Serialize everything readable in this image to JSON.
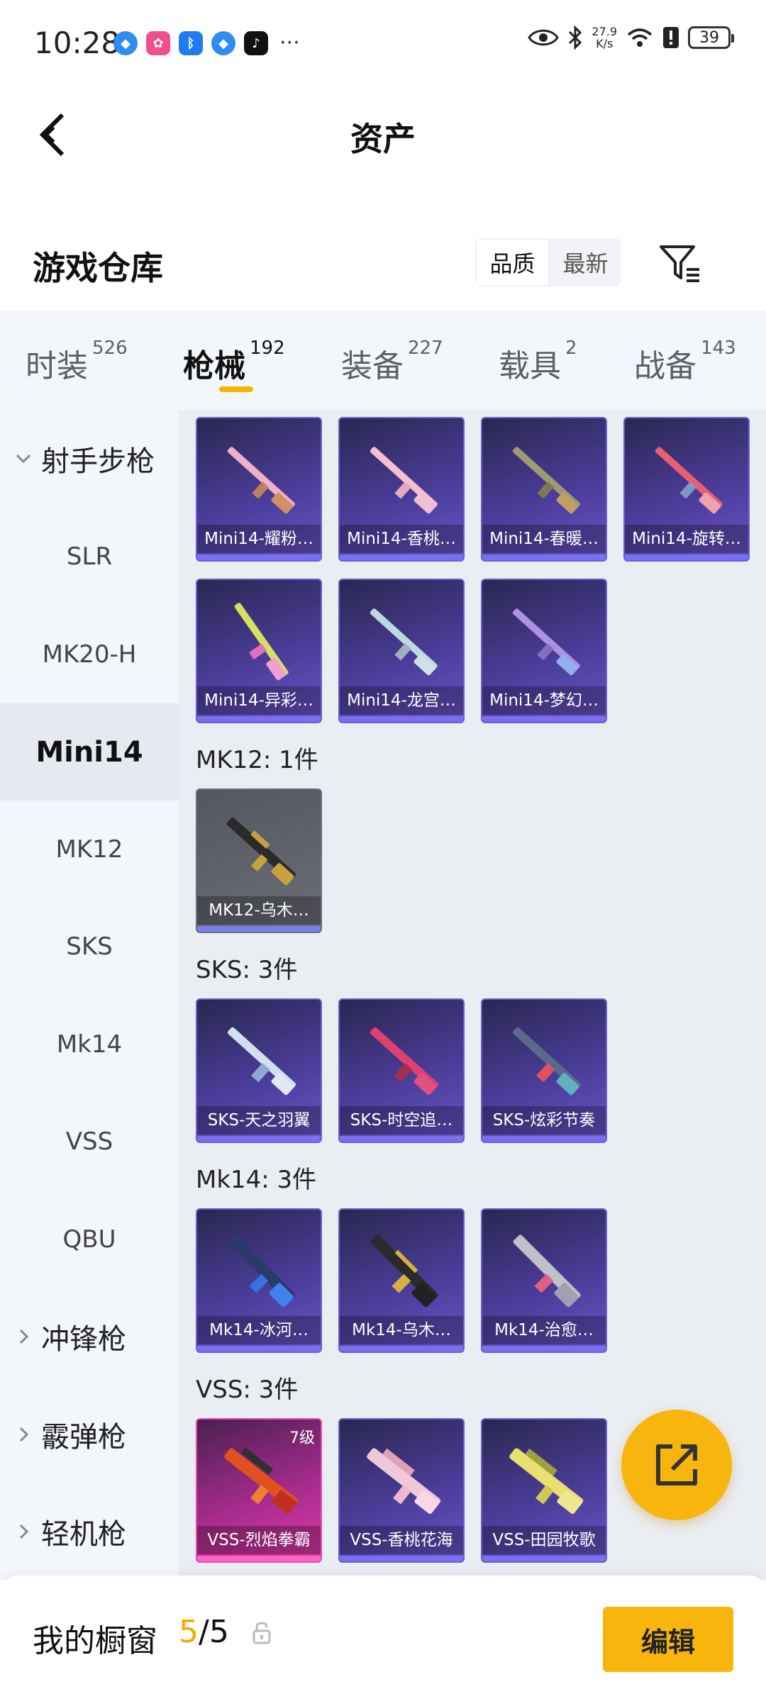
{
  "status_bar": {
    "time": "10:28",
    "speed_value": "27.9",
    "speed_unit": "K/s",
    "battery": "39",
    "more": "···"
  },
  "nav": {
    "title": "资产"
  },
  "header": {
    "section_title": "游戏仓库",
    "sort_options": [
      "品质",
      "最新"
    ],
    "active_sort": "品质"
  },
  "tabs": [
    {
      "label": "时装",
      "count": "526"
    },
    {
      "label": "枪械",
      "count": "192"
    },
    {
      "label": "装备",
      "count": "227"
    },
    {
      "label": "载具",
      "count": "2"
    },
    {
      "label": "战备",
      "count": "143"
    }
  ],
  "active_tab": "枪械",
  "sidebar": {
    "group_open": "射手步枪",
    "items": [
      "SLR",
      "MK20-H",
      "Mini14",
      "MK12",
      "SKS",
      "Mk14",
      "VSS",
      "QBU"
    ],
    "active_item": "Mini14",
    "collapsed_groups": [
      "冲锋枪",
      "霰弹枪",
      "轻机枪"
    ]
  },
  "content": {
    "mini14_items": [
      "Mini14-耀粉…",
      "Mini14-香桃…",
      "Mini14-春暖…",
      "Mini14-旋转…",
      "Mini14-异彩…",
      "Mini14-龙宫…",
      "Mini14-梦幻…"
    ],
    "groups": [
      {
        "label": "MK12: 1件",
        "items": [
          "MK12-乌木…"
        ]
      },
      {
        "label": "SKS: 3件",
        "items": [
          "SKS-天之羽翼",
          "SKS-时空追…",
          "SKS-炫彩节奏"
        ]
      },
      {
        "label": "Mk14: 3件",
        "items": [
          "Mk14-冰河…",
          "Mk14-乌木…",
          "Mk14-治愈…"
        ]
      },
      {
        "label": "VSS: 3件",
        "items": [
          "VSS-烈焰拳霸",
          "VSS-香桃花海",
          "VSS-田园牧歌"
        ],
        "first_level": "7级"
      }
    ]
  },
  "bottom_bar": {
    "title": "我的橱窗",
    "current": "5",
    "total": "/5",
    "edit_label": "编辑"
  },
  "colors": {
    "accent": "#f8b50e",
    "card_purple": "#4a3c98",
    "card_pink": "#e03aaa",
    "sidebar_bg": "#f3f6fb"
  }
}
